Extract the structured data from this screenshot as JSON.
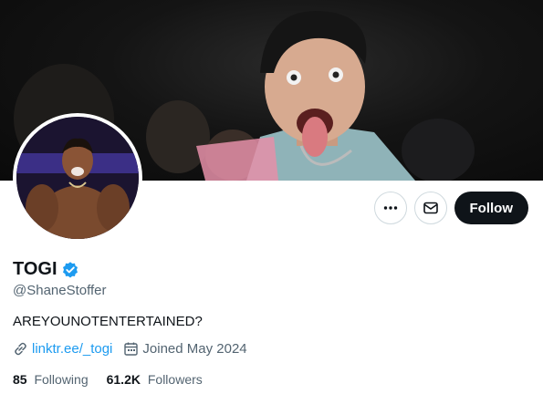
{
  "profile": {
    "name": "TOGI",
    "handle": "@ShaneStoffer",
    "bio": "AREYOUNOTENTERTAINED?",
    "link": "linktr.ee/_togi",
    "joined": "Joined May 2024",
    "following_count": "85",
    "following_label": "Following",
    "followers_count": "61.2K",
    "followers_label": "Followers",
    "verified": true
  },
  "actions": {
    "more_icon": "more-horizontal-icon",
    "message_icon": "mail-icon",
    "follow_label": "Follow"
  },
  "colors": {
    "accent": "#1d9bf0",
    "text": "#0f1419",
    "muted": "#536471",
    "follow_bg": "#0f1419"
  }
}
